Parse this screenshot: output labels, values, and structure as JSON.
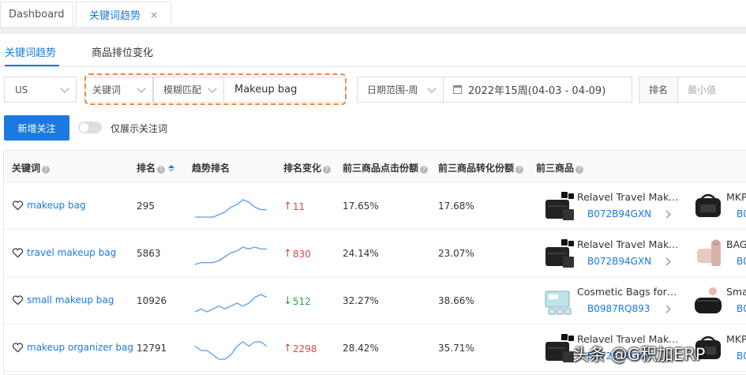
{
  "window_tabs": [
    {
      "label": "Dashboard"
    },
    {
      "label": "关键词趋势",
      "close": "×"
    }
  ],
  "sub_tabs": [
    {
      "label": "关键词趋势"
    },
    {
      "label": "商品排位变化"
    }
  ],
  "filters": {
    "marketplace": "US",
    "field": "关键词",
    "match": "模糊匹配",
    "keyword_value": "Makeup bag",
    "date_range_type": "日期范围-周",
    "week": "2022年15周(04-03 - 04-09)",
    "rank_label": "排名",
    "rank_min_placeholder": "最小值"
  },
  "actions": {
    "add_follow": "新增关注",
    "only_followed": "仅展示关注词"
  },
  "table": {
    "headers": {
      "keyword": "关键词",
      "rank": "排名",
      "trend_rank": "趋势排名",
      "rank_change": "排名变化",
      "click_share": "前三商品点击份额",
      "conv_share": "前三商品转化份额",
      "top3": "前三商品"
    },
    "rows": [
      {
        "keyword": "makeup bag",
        "rank": "295",
        "change": {
          "dir": "up",
          "value": "11"
        },
        "click_share": "17.65%",
        "conv_share": "17.68%",
        "trend": [
          5,
          5,
          5,
          5,
          6,
          7,
          9,
          10,
          12,
          11,
          9,
          8,
          8
        ],
        "p1": {
          "title": "Relavel Travel Make...",
          "asin": "B072B94GXN",
          "image": "black-makeup-case"
        },
        "p2": {
          "title": "MKP",
          "asin": "B0",
          "image": "black-toiletry-bag"
        }
      },
      {
        "keyword": "travel makeup bag",
        "rank": "5863",
        "change": {
          "dir": "up",
          "value": "830"
        },
        "click_share": "24.14%",
        "conv_share": "23.07%",
        "trend": [
          4,
          5,
          5,
          5,
          6,
          8,
          10,
          11,
          13,
          12,
          13,
          12,
          12
        ],
        "p1": {
          "title": "Relavel Travel Make...",
          "asin": "B072B94GXN",
          "image": "black-makeup-case"
        },
        "p2": {
          "title": "BAG",
          "asin": "B0",
          "image": "pink-hanging-bag"
        }
      },
      {
        "keyword": "small makeup bag",
        "rank": "10926",
        "change": {
          "dir": "down",
          "value": "512"
        },
        "click_share": "32.27%",
        "conv_share": "38.66%",
        "trend": [
          6,
          7,
          6,
          7,
          8,
          7,
          8,
          9,
          8,
          9,
          11,
          12,
          11
        ],
        "p1": {
          "title": "Cosmetic Bags for W...",
          "asin": "B0987RQ893",
          "image": "clear-cosmetic-bag"
        },
        "p2": {
          "title": "Smal",
          "asin": "B0",
          "image": "black-pouch"
        }
      },
      {
        "keyword": "makeup organizer bag",
        "rank": "12791",
        "change": {
          "dir": "up",
          "value": "2298"
        },
        "click_share": "28.42%",
        "conv_share": "35.71%",
        "trend": [
          9,
          8,
          8,
          7,
          6,
          6,
          7,
          9,
          10,
          9,
          10,
          10,
          9
        ],
        "p1": {
          "title": "Relavel Travel Make...",
          "asin": "B072B94GXN",
          "image": "black-makeup-case"
        },
        "p2": {
          "title": "MKP",
          "asin": "B0",
          "image": "black-toiletry-bag"
        }
      }
    ]
  },
  "watermark": "头条 @G积加ERP",
  "colors": {
    "accent": "#1a7ae0",
    "up": "#e64545",
    "down": "#2e9e4f",
    "highlight": "#f0883e",
    "spark": "#5b9bea"
  }
}
